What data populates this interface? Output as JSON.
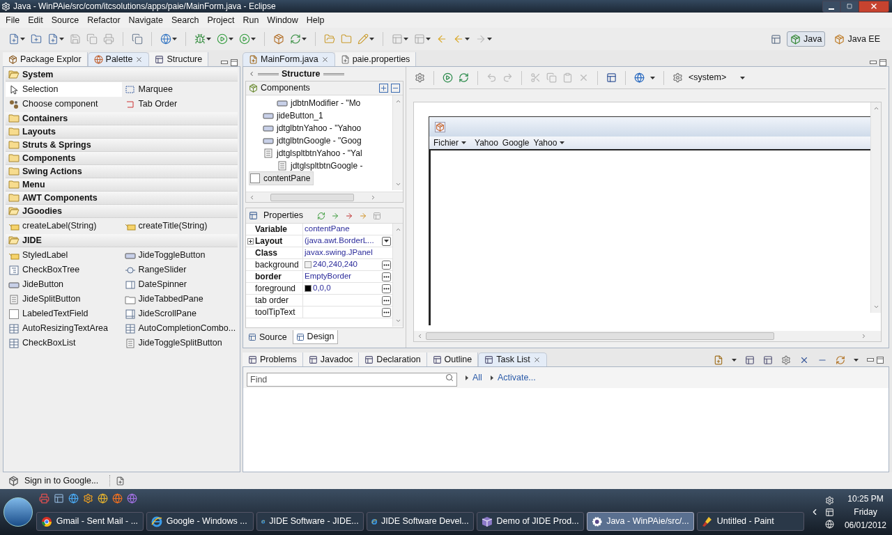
{
  "window": {
    "title": "Java - WinPAie/src/com/itcsolutions/apps/paie/MainForm.java - Eclipse"
  },
  "menu": [
    "File",
    "Edit",
    "Source",
    "Refactor",
    "Navigate",
    "Search",
    "Project",
    "Run",
    "Window",
    "Help"
  ],
  "perspectives": [
    {
      "label": "Java",
      "selected": true
    },
    {
      "label": "Java EE",
      "selected": false
    }
  ],
  "left_tabs": [
    {
      "label": "Package Explor",
      "selected": false
    },
    {
      "label": "Palette",
      "selected": true
    },
    {
      "label": "Structure",
      "selected": false
    }
  ],
  "palette": [
    {
      "label": "System",
      "expanded": true,
      "items": [
        {
          "label": "Selection",
          "kind": "cursor",
          "selected": true
        },
        {
          "label": "Marquee",
          "kind": "marquee",
          "selected": false
        },
        {
          "label": "Choose component",
          "kind": "chooser",
          "selected": false
        },
        {
          "label": "Tab Order",
          "kind": "taborder",
          "selected": false
        }
      ]
    },
    {
      "label": "Containers",
      "expanded": false
    },
    {
      "label": "Layouts",
      "expanded": false
    },
    {
      "label": "Struts & Springs",
      "expanded": false
    },
    {
      "label": "Components",
      "expanded": false
    },
    {
      "label": "Swing Actions",
      "expanded": false
    },
    {
      "label": "Menu",
      "expanded": false
    },
    {
      "label": "AWT Components",
      "expanded": false
    },
    {
      "label": "JGoodies",
      "expanded": true,
      "items": [
        {
          "label": "createLabel(String)",
          "kind": "label",
          "selected": false
        },
        {
          "label": "createTitle(String)",
          "kind": "label",
          "selected": false
        }
      ]
    },
    {
      "label": "JIDE",
      "expanded": true,
      "items": [
        {
          "label": "StyledLabel",
          "kind": "label",
          "selected": false
        },
        {
          "label": "JideToggleButton",
          "kind": "button",
          "selected": false
        },
        {
          "label": "CheckBoxTree",
          "kind": "tree",
          "selected": false
        },
        {
          "label": "RangeSlider",
          "kind": "slider",
          "selected": false
        },
        {
          "label": "JideButton",
          "kind": "button",
          "selected": false
        },
        {
          "label": "DateSpinner",
          "kind": "spinner",
          "selected": false
        },
        {
          "label": "JideSplitButton",
          "kind": "list",
          "selected": false
        },
        {
          "label": "JideTabbedPane",
          "kind": "tabbed",
          "selected": false
        },
        {
          "label": "LabeledTextField",
          "kind": "field",
          "selected": false
        },
        {
          "label": "JideScrollPane",
          "kind": "scroll",
          "selected": false
        },
        {
          "label": "AutoResizingTextArea",
          "kind": "grid",
          "selected": false
        },
        {
          "label": "AutoCompletionCombo...",
          "kind": "grid",
          "selected": false
        },
        {
          "label": "CheckBoxList",
          "kind": "grid",
          "selected": false
        },
        {
          "label": "JideToggleSplitButton",
          "kind": "list",
          "selected": false
        }
      ]
    }
  ],
  "editor_tabs": [
    {
      "label": "MainForm.java",
      "selected": true
    },
    {
      "label": "paie.properties",
      "selected": false
    }
  ],
  "structure": {
    "title": "Structure",
    "components_title": "Components",
    "tree": [
      {
        "children": [
          {
            "children": [
              {
                "label": "jdbtnModifier - \"Mo",
                "kind": "button",
                "selected": false
              }
            ]
          },
          {
            "label": "jideButton_1",
            "kind": "button",
            "selected": false
          },
          {
            "label": "jdtglbtnYahoo - \"Yahoo",
            "kind": "button",
            "selected": false
          },
          {
            "label": "jdtglbtnGoogle - \"Goog",
            "kind": "button",
            "selected": false
          },
          {
            "label": "jdtglspltbtnYahoo - \"Yal",
            "kind": "list",
            "selected": false,
            "children": [
              {
                "label": "jdtglspltbtnGoogle -",
                "kind": "list",
                "selected": false
              }
            ]
          }
        ]
      },
      {
        "label": "contentPane",
        "kind": "field",
        "selected": true
      }
    ]
  },
  "properties": {
    "title": "Properties",
    "rows": [
      {
        "name": "Variable",
        "value": "contentPane",
        "bold": true,
        "kind": "plain"
      },
      {
        "name": "Layout",
        "value": "(java.awt.BorderL...",
        "bold": true,
        "kind": "dropdown",
        "expanded": false
      },
      {
        "name": "Class",
        "value": "javax.swing.JPanel",
        "bold": true,
        "kind": "plain"
      },
      {
        "name": "background",
        "value": "240,240,240",
        "bold": false,
        "kind": "dialog",
        "color": "#f0f0f0"
      },
      {
        "name": "border",
        "value": "EmptyBorder",
        "bold": true,
        "kind": "dialog"
      },
      {
        "name": "foreground",
        "value": "0,0,0",
        "bold": false,
        "kind": "dialog",
        "color": "#000000"
      },
      {
        "name": "tab order",
        "bold": false,
        "kind": "dialog"
      },
      {
        "name": "toolTipText",
        "bold": false,
        "kind": "dialog"
      }
    ]
  },
  "editor_mode_tabs": [
    {
      "label": "Source",
      "selected": false
    },
    {
      "label": "Design",
      "selected": true
    }
  ],
  "designer": {
    "look": "<system>",
    "frame_menu": [
      {
        "label": "Fichier",
        "dropdown": true
      },
      {
        "label": "Yahoo",
        "dropdown": false
      },
      {
        "label": "Google",
        "dropdown": false
      },
      {
        "label": "Yahoo",
        "dropdown": true
      }
    ]
  },
  "bottom_tabs": [
    {
      "label": "Problems",
      "selected": false
    },
    {
      "label": "Javadoc",
      "selected": false
    },
    {
      "label": "Declaration",
      "selected": false
    },
    {
      "label": "Outline",
      "selected": false
    },
    {
      "label": "Task List",
      "selected": true
    }
  ],
  "task_list": {
    "find_placeholder": "Find",
    "links": [
      "All",
      "Activate..."
    ]
  },
  "status_bar": {
    "message": "Sign in to Google..."
  },
  "taskbar": {
    "tasks": [
      {
        "label": "Gmail - Sent Mail - ...",
        "kind": "chrome",
        "selected": false
      },
      {
        "label": "Google - Windows ...",
        "kind": "ie",
        "selected": false
      },
      {
        "label": "JIDE Software - JIDE...",
        "kind": "ie",
        "selected": false
      },
      {
        "label": "JIDE Software Devel...",
        "kind": "ie",
        "selected": false
      },
      {
        "label": "Demo of JIDE Prod...",
        "kind": "box",
        "selected": false
      },
      {
        "label": "Java - WinPAie/src/...",
        "kind": "eclipse",
        "selected": true
      },
      {
        "label": "Untitled - Paint",
        "kind": "paint",
        "selected": false
      }
    ],
    "clock": {
      "time": "10:25 PM",
      "day": "Friday",
      "date": "06/01/2012"
    }
  }
}
